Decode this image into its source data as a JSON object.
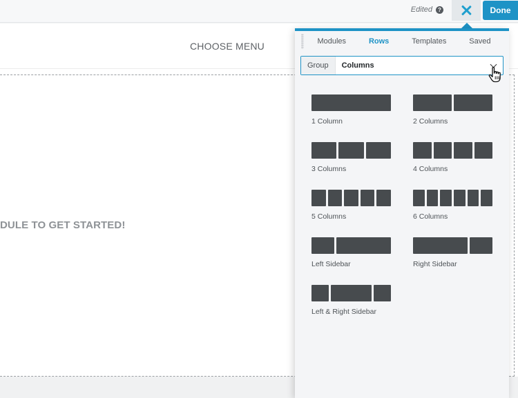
{
  "topbar": {
    "edited_label": "Edited",
    "help_icon": "question-circle-icon",
    "close_icon": "close-icon",
    "done_label": "Done"
  },
  "page": {
    "menu_label": "CHOOSE MENU",
    "drop_text": "DULE TO GET STARTED!"
  },
  "panel": {
    "tabs": [
      {
        "label": "Modules",
        "active": false
      },
      {
        "label": "Rows",
        "active": true
      },
      {
        "label": "Templates",
        "active": false
      },
      {
        "label": "Saved",
        "active": false
      }
    ],
    "group": {
      "label": "Group",
      "value": "Columns"
    },
    "layouts": [
      {
        "label": "1 Column",
        "columns": [
          1
        ]
      },
      {
        "label": "2 Columns",
        "columns": [
          1,
          1
        ]
      },
      {
        "label": "3 Columns",
        "columns": [
          1,
          1,
          1
        ]
      },
      {
        "label": "4 Columns",
        "columns": [
          1,
          1,
          1,
          1
        ]
      },
      {
        "label": "5 Columns",
        "columns": [
          1,
          1,
          1,
          1,
          1
        ]
      },
      {
        "label": "6 Columns",
        "columns": [
          1,
          1,
          1,
          1,
          1,
          1
        ]
      },
      {
        "label": "Left Sidebar",
        "columns": [
          1,
          2.4
        ]
      },
      {
        "label": "Right Sidebar",
        "columns": [
          2.4,
          1
        ]
      },
      {
        "label": "Left & Right Sidebar",
        "columns": [
          1,
          2.4,
          1
        ]
      }
    ]
  },
  "colors": {
    "accent": "#1e93c6",
    "block": "#474b4e"
  }
}
